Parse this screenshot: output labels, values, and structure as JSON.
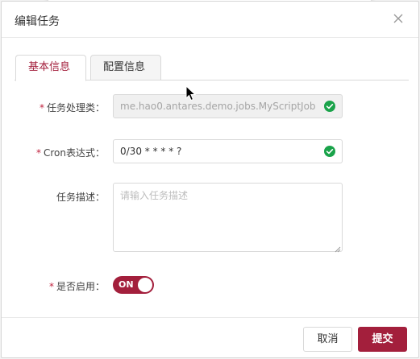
{
  "dialog": {
    "title": "编辑任务",
    "close_icon": "close-icon"
  },
  "tabs": [
    {
      "label": "基本信息",
      "active": true
    },
    {
      "label": "配置信息",
      "active": false
    }
  ],
  "form": {
    "handler": {
      "required_mark": "*",
      "label": "任务处理类：",
      "value": "me.hao0.antares.demo.jobs.MyScriptJob",
      "disabled": true,
      "valid": true
    },
    "cron": {
      "required_mark": "*",
      "label": "Cron表达式：",
      "value": "0/30 * * * * ?",
      "valid": true
    },
    "description": {
      "label": "任务描述：",
      "value": "",
      "placeholder": "请输入任务描述"
    },
    "enabled": {
      "required_mark": "*",
      "label": "是否启用：",
      "toggle_text": "ON",
      "on": true
    }
  },
  "footer": {
    "cancel_label": "取消",
    "submit_label": "提交"
  },
  "colors": {
    "accent": "#a31f3c",
    "success": "#1aa34a"
  }
}
